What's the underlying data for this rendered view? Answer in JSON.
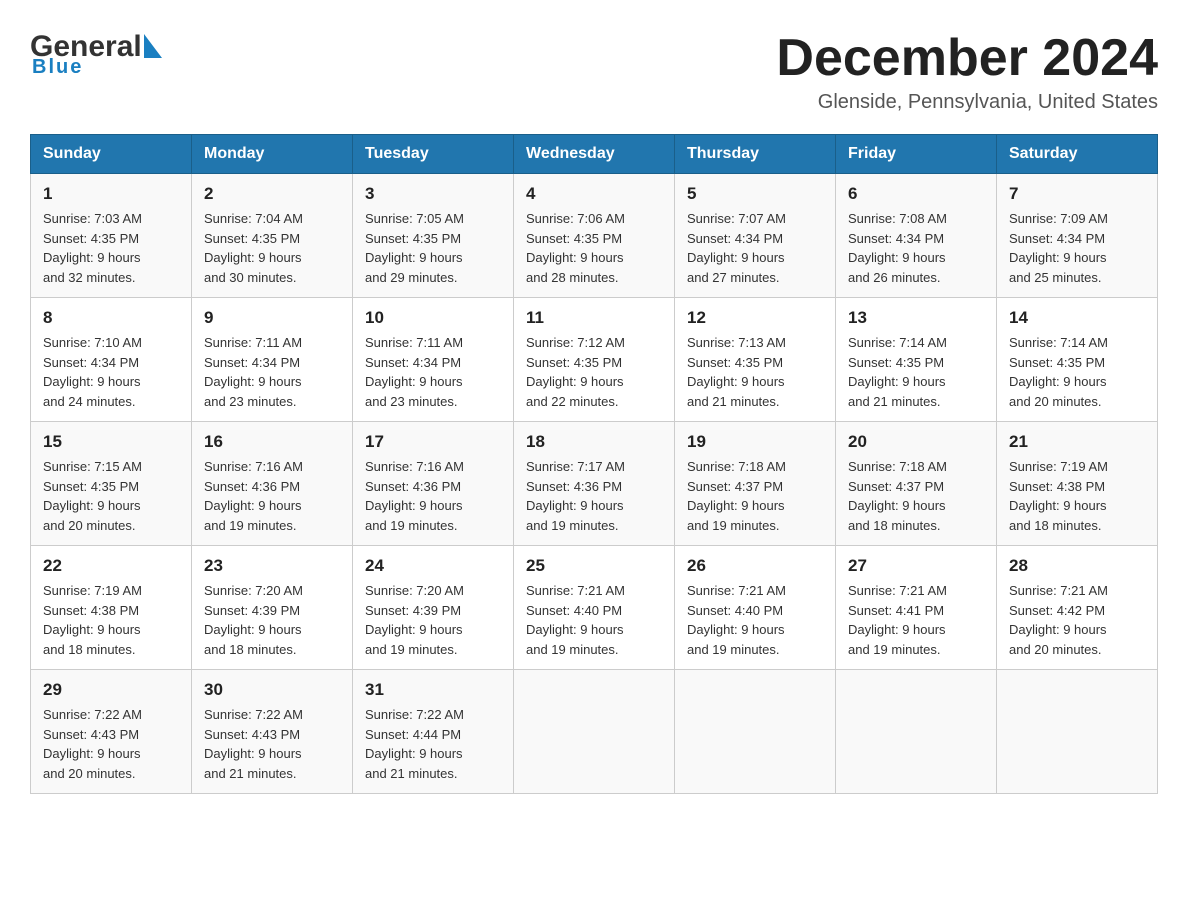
{
  "header": {
    "logo_general": "General",
    "logo_blue": "Blue",
    "month_title": "December 2024",
    "location": "Glenside, Pennsylvania, United States"
  },
  "weekdays": [
    "Sunday",
    "Monday",
    "Tuesday",
    "Wednesday",
    "Thursday",
    "Friday",
    "Saturday"
  ],
  "rows": [
    [
      {
        "day": "1",
        "sunrise": "7:03 AM",
        "sunset": "4:35 PM",
        "daylight": "9 hours and 32 minutes."
      },
      {
        "day": "2",
        "sunrise": "7:04 AM",
        "sunset": "4:35 PM",
        "daylight": "9 hours and 30 minutes."
      },
      {
        "day": "3",
        "sunrise": "7:05 AM",
        "sunset": "4:35 PM",
        "daylight": "9 hours and 29 minutes."
      },
      {
        "day": "4",
        "sunrise": "7:06 AM",
        "sunset": "4:35 PM",
        "daylight": "9 hours and 28 minutes."
      },
      {
        "day": "5",
        "sunrise": "7:07 AM",
        "sunset": "4:34 PM",
        "daylight": "9 hours and 27 minutes."
      },
      {
        "day": "6",
        "sunrise": "7:08 AM",
        "sunset": "4:34 PM",
        "daylight": "9 hours and 26 minutes."
      },
      {
        "day": "7",
        "sunrise": "7:09 AM",
        "sunset": "4:34 PM",
        "daylight": "9 hours and 25 minutes."
      }
    ],
    [
      {
        "day": "8",
        "sunrise": "7:10 AM",
        "sunset": "4:34 PM",
        "daylight": "9 hours and 24 minutes."
      },
      {
        "day": "9",
        "sunrise": "7:11 AM",
        "sunset": "4:34 PM",
        "daylight": "9 hours and 23 minutes."
      },
      {
        "day": "10",
        "sunrise": "7:11 AM",
        "sunset": "4:34 PM",
        "daylight": "9 hours and 23 minutes."
      },
      {
        "day": "11",
        "sunrise": "7:12 AM",
        "sunset": "4:35 PM",
        "daylight": "9 hours and 22 minutes."
      },
      {
        "day": "12",
        "sunrise": "7:13 AM",
        "sunset": "4:35 PM",
        "daylight": "9 hours and 21 minutes."
      },
      {
        "day": "13",
        "sunrise": "7:14 AM",
        "sunset": "4:35 PM",
        "daylight": "9 hours and 21 minutes."
      },
      {
        "day": "14",
        "sunrise": "7:14 AM",
        "sunset": "4:35 PM",
        "daylight": "9 hours and 20 minutes."
      }
    ],
    [
      {
        "day": "15",
        "sunrise": "7:15 AM",
        "sunset": "4:35 PM",
        "daylight": "9 hours and 20 minutes."
      },
      {
        "day": "16",
        "sunrise": "7:16 AM",
        "sunset": "4:36 PM",
        "daylight": "9 hours and 19 minutes."
      },
      {
        "day": "17",
        "sunrise": "7:16 AM",
        "sunset": "4:36 PM",
        "daylight": "9 hours and 19 minutes."
      },
      {
        "day": "18",
        "sunrise": "7:17 AM",
        "sunset": "4:36 PM",
        "daylight": "9 hours and 19 minutes."
      },
      {
        "day": "19",
        "sunrise": "7:18 AM",
        "sunset": "4:37 PM",
        "daylight": "9 hours and 19 minutes."
      },
      {
        "day": "20",
        "sunrise": "7:18 AM",
        "sunset": "4:37 PM",
        "daylight": "9 hours and 18 minutes."
      },
      {
        "day": "21",
        "sunrise": "7:19 AM",
        "sunset": "4:38 PM",
        "daylight": "9 hours and 18 minutes."
      }
    ],
    [
      {
        "day": "22",
        "sunrise": "7:19 AM",
        "sunset": "4:38 PM",
        "daylight": "9 hours and 18 minutes."
      },
      {
        "day": "23",
        "sunrise": "7:20 AM",
        "sunset": "4:39 PM",
        "daylight": "9 hours and 18 minutes."
      },
      {
        "day": "24",
        "sunrise": "7:20 AM",
        "sunset": "4:39 PM",
        "daylight": "9 hours and 19 minutes."
      },
      {
        "day": "25",
        "sunrise": "7:21 AM",
        "sunset": "4:40 PM",
        "daylight": "9 hours and 19 minutes."
      },
      {
        "day": "26",
        "sunrise": "7:21 AM",
        "sunset": "4:40 PM",
        "daylight": "9 hours and 19 minutes."
      },
      {
        "day": "27",
        "sunrise": "7:21 AM",
        "sunset": "4:41 PM",
        "daylight": "9 hours and 19 minutes."
      },
      {
        "day": "28",
        "sunrise": "7:21 AM",
        "sunset": "4:42 PM",
        "daylight": "9 hours and 20 minutes."
      }
    ],
    [
      {
        "day": "29",
        "sunrise": "7:22 AM",
        "sunset": "4:43 PM",
        "daylight": "9 hours and 20 minutes."
      },
      {
        "day": "30",
        "sunrise": "7:22 AM",
        "sunset": "4:43 PM",
        "daylight": "9 hours and 21 minutes."
      },
      {
        "day": "31",
        "sunrise": "7:22 AM",
        "sunset": "4:44 PM",
        "daylight": "9 hours and 21 minutes."
      },
      null,
      null,
      null,
      null
    ]
  ],
  "labels": {
    "sunrise": "Sunrise:",
    "sunset": "Sunset:",
    "daylight": "Daylight:"
  }
}
